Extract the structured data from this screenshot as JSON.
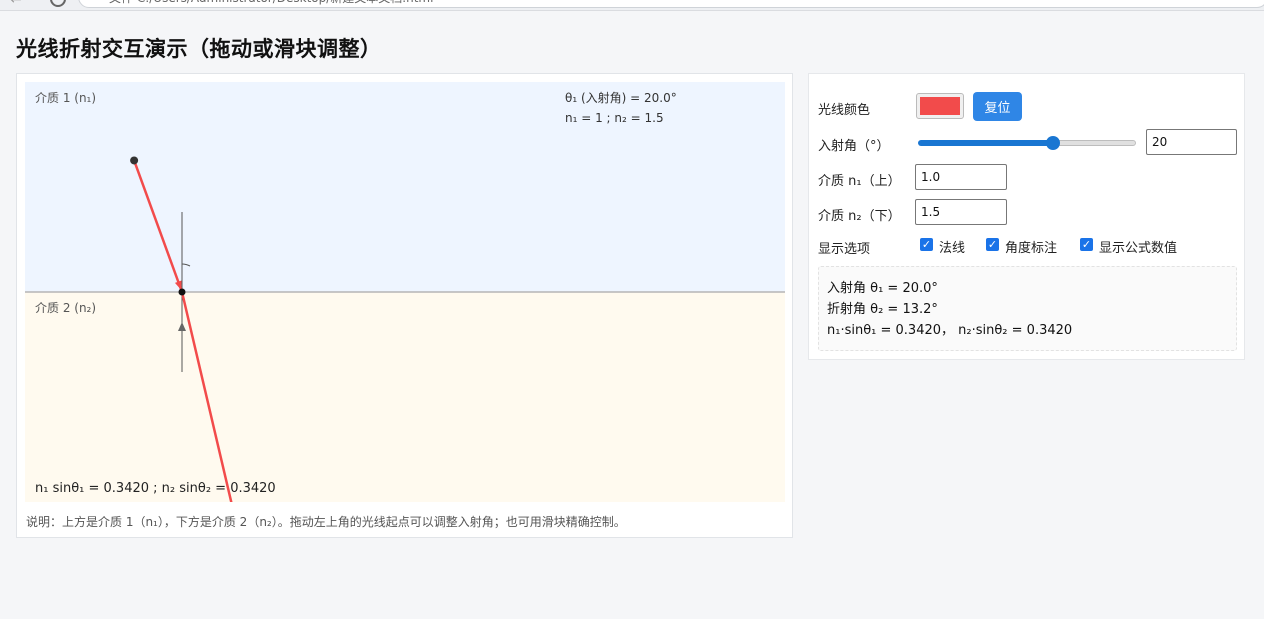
{
  "browser": {
    "url": "文件   C:/Users/Administrator/Desktop/新建文本文档.html"
  },
  "page": {
    "title": "光线折射交互演示（拖动或滑块调整）"
  },
  "scene": {
    "medium1_label": "介质 1 (n₁)",
    "medium2_label": "介质 2 (n₂)",
    "angle_readout": "θ₁ (入射角) = 20.0°",
    "index_readout": "n₁ = 1 ;   n₂ = 1.5",
    "snell_readout": "n₁ sinθ₁ = 0.3420 ; n₂ sinθ₂ = 0.3420",
    "incident_angle_deg": 20,
    "refracted_angle_deg": 13.2,
    "colors": {
      "medium1_bg": "#eef5ff",
      "medium2_bg": "#fffaef",
      "ray": "#f24b4b",
      "interface": "#b5b5b5",
      "normal": "#555555"
    }
  },
  "caption": "说明：上方是介质 1（n₁），下方是介质 2（n₂）。拖动左上角的光线起点可以调整入射角；也可用滑块精确控制。",
  "controls": {
    "ray_color_label": "光线颜色",
    "ray_color_value": "#f24b4b",
    "reset_label": "复位",
    "angle_label": "入射角（°）",
    "angle_value": "20",
    "angle_slider_fraction": 0.62,
    "n1_label": "介质 n₁（上）",
    "n1_value": "1.0",
    "n2_label": "介质 n₂（下）",
    "n2_value": "1.5",
    "options_label": "显示选项",
    "options": [
      {
        "label": "法线",
        "checked": true
      },
      {
        "label": "角度标注",
        "checked": true
      },
      {
        "label": "显示公式数值",
        "checked": true
      }
    ]
  },
  "info": {
    "incident": "入射角 θ₁ = 20.0°",
    "refracted": "折射角 θ₂ = 13.2°",
    "snell": "n₁·sinθ₁ = 0.3420，  n₂·sinθ₂ = 0.3420"
  }
}
